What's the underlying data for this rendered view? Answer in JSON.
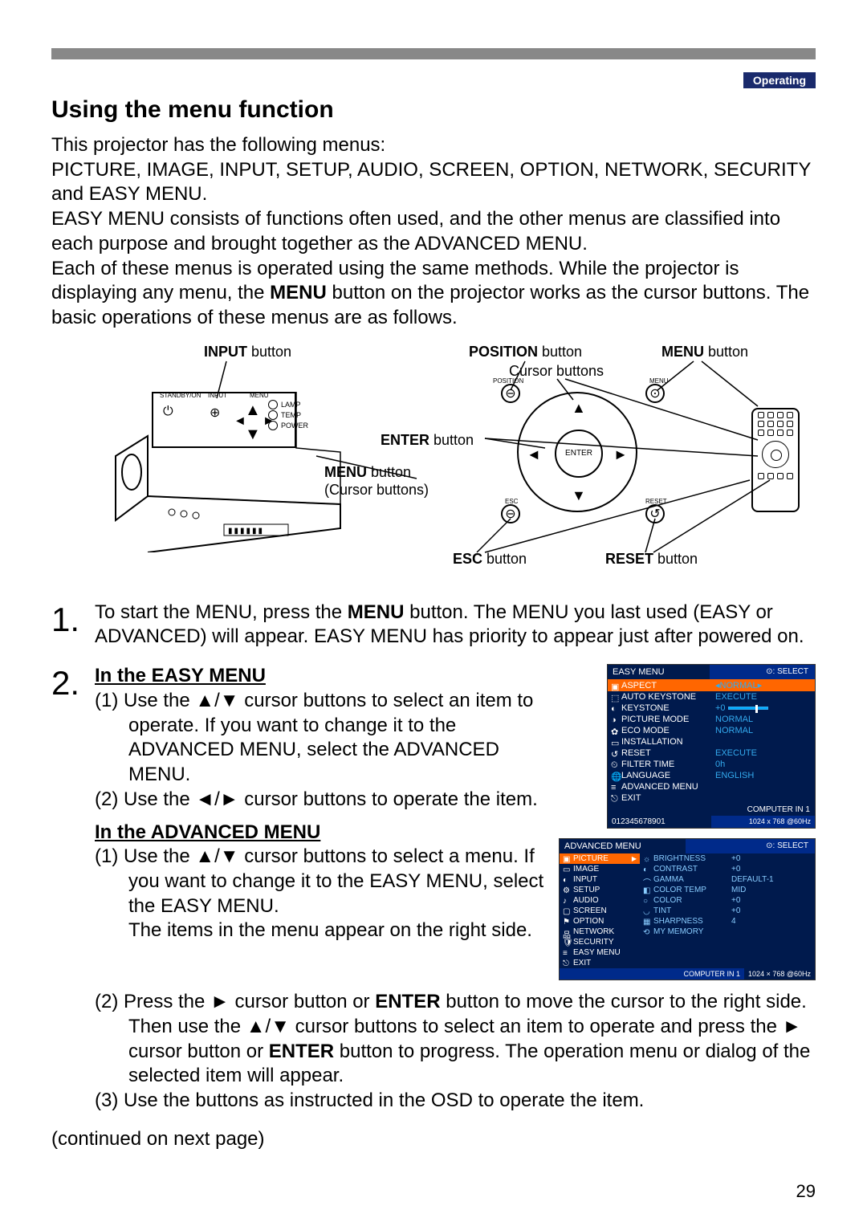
{
  "header": {
    "section": "Operating"
  },
  "title": "Using the menu function",
  "intro": {
    "p1": "This projector has the following menus:",
    "p2": "PICTURE, IMAGE, INPUT, SETUP, AUDIO, SCREEN, OPTION, NETWORK, SECURITY and EASY MENU.",
    "p3": "EASY MENU consists of functions often used, and the other menus are classified into each purpose and brought together as the ADVANCED MENU.",
    "p4a": "Each of these menus is operated using the same methods. While the projector is displaying any menu, the ",
    "p4b": "MENU",
    "p4c": " button on the projector works as the cursor buttons. The basic operations of these menus are as follows."
  },
  "diagram": {
    "input_btn": "INPUT",
    "input_suffix": " button",
    "position_btn": "POSITION",
    "position_suffix": " button",
    "menu_btn": "MENU",
    "menu_suffix": " button",
    "cursor_btns": "Cursor buttons",
    "enter_btn": "ENTER",
    "enter_suffix": " button",
    "menu_btn2": "MENU",
    "menu_suffix2": " button",
    "cursor_btns2": "(Cursor buttons)",
    "esc_btn": "ESC",
    "esc_suffix": " button",
    "reset_btn": "RESET",
    "reset_suffix": " button",
    "panel": {
      "standby": "STANDBY/ON",
      "input": "INPUT",
      "menu": "MENU",
      "lamp": "LAMP",
      "temp": "TEMP",
      "power": "POWER"
    },
    "dpad": {
      "position": "POSITION",
      "menu": "MENU",
      "enter": "ENTER",
      "esc": "ESC",
      "reset": "RESET"
    }
  },
  "steps": {
    "n1": "1.",
    "s1a": "To start the MENU, press the ",
    "s1b": "MENU",
    "s1c": " button. The MENU you last used (EASY or ADVANCED) will appear. EASY MENU has priority to appear just after powered on.",
    "n2": "2.",
    "s2_title": "In the EASY MENU",
    "s2_1": "(1) Use the ▲/▼ cursor buttons to select an item to operate. If you want to change it to the ADVANCED MENU, select the ADVANCED MENU.",
    "s2_2": "(2) Use the ◄/► cursor buttons to operate the item.",
    "s2_adv_title": "In the ADVANCED MENU",
    "s2_adv_1a": "(1) Use the ▲/▼ cursor buttons to select a menu. If you want to change it to the EASY MENU, select the EASY MENU.",
    "s2_adv_1b": "The items in the menu appear on the right side.",
    "s2_adv_2a": "(2) Press the ► cursor button or ",
    "s2_adv_2b": "ENTER",
    "s2_adv_2c": " button to move the cursor to the right side. Then use the ▲/▼ cursor buttons to select an item to operate and press the ► cursor button or ",
    "s2_adv_2d": "ENTER",
    "s2_adv_2e": " button to progress. The operation menu or dialog of the selected item will appear.",
    "s2_adv_3": "(3) Use the buttons as instructed in the OSD to operate the item."
  },
  "easy_menu": {
    "title": "EASY MENU",
    "select": "⊙: SELECT",
    "rows": [
      {
        "icon": "▣",
        "label": "ASPECT",
        "val": "NORMAL",
        "hl": true,
        "arrow": true
      },
      {
        "icon": "⬚",
        "label": "AUTO KEYSTONE",
        "val": "EXECUTE"
      },
      {
        "icon": "◐",
        "label": "KEYSTONE",
        "val": "+0",
        "slider": true
      },
      {
        "icon": "◑",
        "label": "PICTURE MODE",
        "val": "NORMAL"
      },
      {
        "icon": "✿",
        "label": "ECO MODE",
        "val": "NORMAL"
      },
      {
        "icon": "▭",
        "label": "INSTALLATION",
        "val": ""
      },
      {
        "icon": "↺",
        "label": "RESET",
        "val": "EXECUTE"
      },
      {
        "icon": "⏲",
        "label": "FILTER TIME",
        "val": "0h"
      },
      {
        "icon": "🌐",
        "label": "LANGUAGE",
        "val": "ENGLISH"
      },
      {
        "icon": "≡",
        "label": "ADVANCED MENU",
        "val": ""
      },
      {
        "icon": "⎋",
        "label": "EXIT",
        "val": ""
      }
    ],
    "footer_src": "COMPUTER IN 1",
    "footer_sn": "012345678901",
    "footer_res": "1024 x 768 @60Hz"
  },
  "adv_menu": {
    "title": "ADVANCED MENU",
    "select": "⊙: SELECT",
    "left": [
      {
        "icon": "▣",
        "label": "PICTURE",
        "hl": true
      },
      {
        "icon": "▭",
        "label": "IMAGE"
      },
      {
        "icon": "◐",
        "label": "INPUT"
      },
      {
        "icon": "⚙",
        "label": "SETUP"
      },
      {
        "icon": "♪",
        "label": "AUDIO"
      },
      {
        "icon": "▢",
        "label": "SCREEN"
      },
      {
        "icon": "⚑",
        "label": "OPTION"
      },
      {
        "icon": "品",
        "label": "NETWORK"
      },
      {
        "icon": "🛡",
        "label": "SECURITY"
      },
      {
        "icon": "≡",
        "label": "EASY MENU"
      },
      {
        "icon": "⎋",
        "label": "EXIT"
      }
    ],
    "mid": [
      {
        "icon": "☼",
        "label": "BRIGHTNESS",
        "val": "+0"
      },
      {
        "icon": "◐",
        "label": "CONTRAST",
        "val": "+0"
      },
      {
        "icon": "⌒",
        "label": "GAMMA",
        "val": "DEFAULT-1"
      },
      {
        "icon": "◧",
        "label": "COLOR TEMP",
        "val": "MID"
      },
      {
        "icon": "○",
        "label": "COLOR",
        "val": "+0"
      },
      {
        "icon": "◡",
        "label": "TINT",
        "val": "+0"
      },
      {
        "icon": "▦",
        "label": "SHARPNESS",
        "val": "4"
      },
      {
        "icon": "⟲",
        "label": "MY MEMORY",
        "val": ""
      }
    ],
    "footer_src": "COMPUTER IN 1",
    "footer_res": "1024 × 768 @60Hz"
  },
  "continued": "(continued on next page)",
  "page_number": "29"
}
